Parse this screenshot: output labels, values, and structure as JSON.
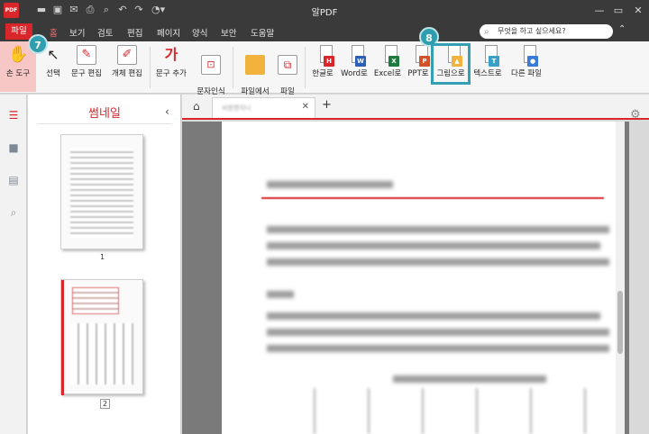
{
  "app": {
    "title": "알PDF",
    "logo_text": "PDF"
  },
  "menu": {
    "file": "파일",
    "home": "홈",
    "items": [
      "보기",
      "검토",
      "편집",
      "페이지",
      "양식",
      "보안",
      "도움말"
    ]
  },
  "search": {
    "placeholder": "무엇을 하고 싶으세요?"
  },
  "ribbon": {
    "hand_tool": "손 도구",
    "select": "선택",
    "text_edit": "문구 편집",
    "object_edit": "개체 편집",
    "text_add": "문구 추가",
    "ocr": "문자인식\n(OCR)",
    "create_from_file": "파일에서\n생성",
    "merge": "파일\n병합",
    "to_hwp": "한글로",
    "to_word": "Word로",
    "to_excel": "Excel로",
    "to_ppt": "PPT로",
    "to_image": "그림으로",
    "to_text": "텍스트로",
    "to_other": "다른 파일"
  },
  "badges": {
    "b7": "7",
    "b8": "8"
  },
  "thumbnails": {
    "title": "썸네일",
    "pages": [
      "1",
      "2"
    ]
  },
  "tabs": {
    "doc_tab": "씨원엔지니"
  },
  "colors": {
    "accent": "#d8262b",
    "highlight": "#35a0b4"
  }
}
